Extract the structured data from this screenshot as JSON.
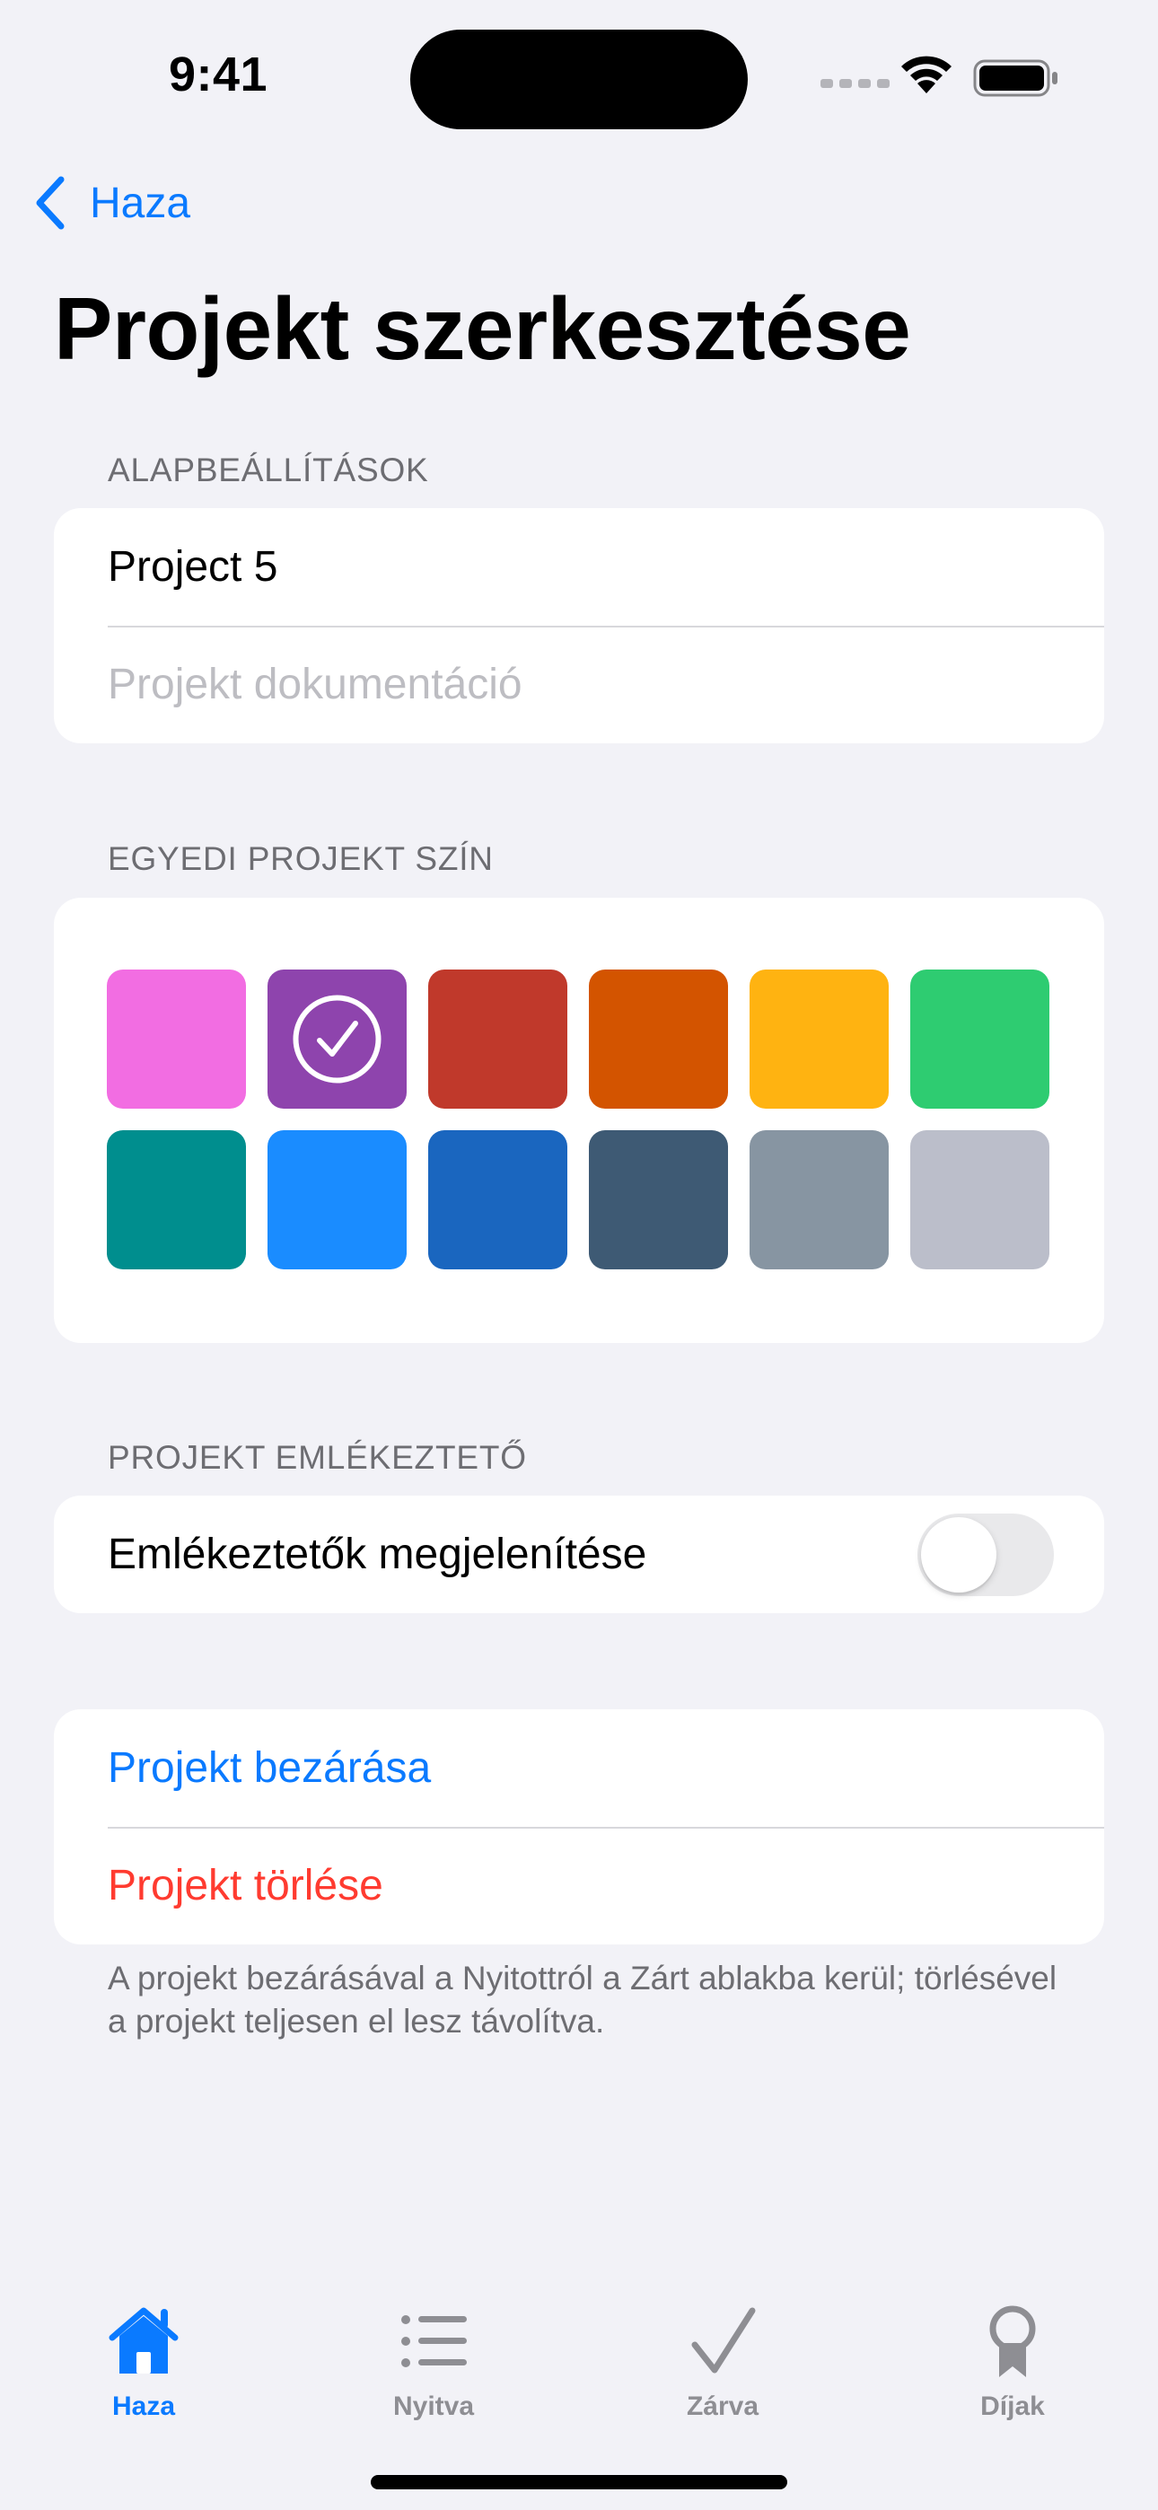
{
  "status_bar": {
    "time": "9:41"
  },
  "nav": {
    "back_label": "Haza",
    "title": "Projekt szerkesztése"
  },
  "basic_settings": {
    "header": "ALAPBEÁLLÍTÁSOK",
    "name_value": "Project 5",
    "doc_placeholder": "Projekt dokumentáció"
  },
  "color_section": {
    "header": "EGYEDI PROJEKT SZÍN",
    "selected_index": 1,
    "colors": [
      "#F26DE2",
      "#8E44AD",
      "#C0392B",
      "#D35400",
      "#FFB311",
      "#2ECC71",
      "#008E8E",
      "#1A8CFF",
      "#1A66BF",
      "#3E5A74",
      "#8795A2",
      "#BBBECA"
    ]
  },
  "reminder_section": {
    "header": "PROJEKT EMLÉKEZTETŐ",
    "toggle_label": "Emlékeztetők megjelenítése",
    "toggle_on": false
  },
  "actions": {
    "close_label": "Projekt bezárása",
    "delete_label": "Projekt törlése",
    "footer": "A projekt bezárásával a Nyitottról a Zárt ablakba kerül; törlésével a projekt teljesen el lesz távolítva."
  },
  "tabbar": {
    "tabs": [
      {
        "label": "Haza",
        "icon": "house-icon",
        "active": true
      },
      {
        "label": "Nyitva",
        "icon": "list-icon",
        "active": false
      },
      {
        "label": "Zárva",
        "icon": "checkmark-icon",
        "active": false
      },
      {
        "label": "Díjak",
        "icon": "award-icon",
        "active": false
      }
    ]
  },
  "accent_colors": {
    "blue": "#0A7AFF",
    "red": "#FF3B30"
  }
}
